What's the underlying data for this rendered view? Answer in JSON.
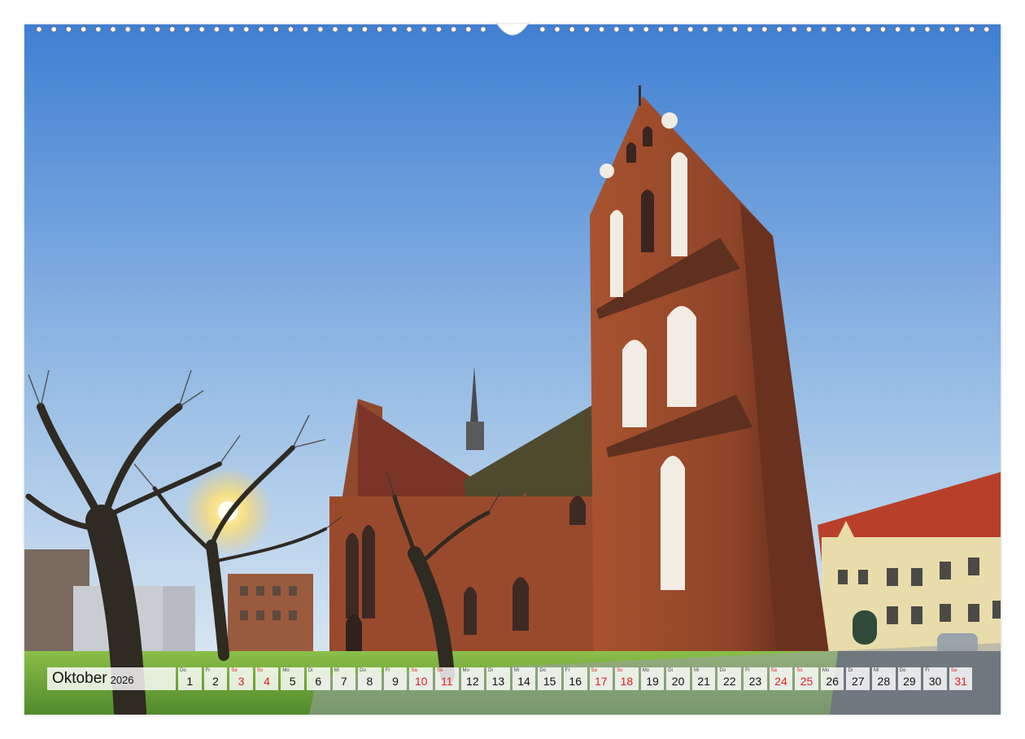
{
  "calendar": {
    "month": "Oktober",
    "year": "2026",
    "days": [
      {
        "wd": "Do",
        "n": "1",
        "weekend": false
      },
      {
        "wd": "Fr",
        "n": "2",
        "weekend": false
      },
      {
        "wd": "Sa",
        "n": "3",
        "weekend": true
      },
      {
        "wd": "So",
        "n": "4",
        "weekend": true
      },
      {
        "wd": "Mo",
        "n": "5",
        "weekend": false
      },
      {
        "wd": "Di",
        "n": "6",
        "weekend": false
      },
      {
        "wd": "Mi",
        "n": "7",
        "weekend": false
      },
      {
        "wd": "Do",
        "n": "8",
        "weekend": false
      },
      {
        "wd": "Fr",
        "n": "9",
        "weekend": false
      },
      {
        "wd": "Sa",
        "n": "10",
        "weekend": true
      },
      {
        "wd": "So",
        "n": "11",
        "weekend": true
      },
      {
        "wd": "Mo",
        "n": "12",
        "weekend": false
      },
      {
        "wd": "Di",
        "n": "13",
        "weekend": false
      },
      {
        "wd": "Mi",
        "n": "14",
        "weekend": false
      },
      {
        "wd": "Do",
        "n": "15",
        "weekend": false
      },
      {
        "wd": "Fr",
        "n": "16",
        "weekend": false
      },
      {
        "wd": "Sa",
        "n": "17",
        "weekend": true
      },
      {
        "wd": "So",
        "n": "18",
        "weekend": true
      },
      {
        "wd": "Mo",
        "n": "19",
        "weekend": false
      },
      {
        "wd": "Di",
        "n": "20",
        "weekend": false
      },
      {
        "wd": "Mi",
        "n": "21",
        "weekend": false
      },
      {
        "wd": "Do",
        "n": "22",
        "weekend": false
      },
      {
        "wd": "Fr",
        "n": "23",
        "weekend": false
      },
      {
        "wd": "Sa",
        "n": "24",
        "weekend": true
      },
      {
        "wd": "So",
        "n": "25",
        "weekend": true
      },
      {
        "wd": "Mo",
        "n": "26",
        "weekend": false
      },
      {
        "wd": "Di",
        "n": "27",
        "weekend": false
      },
      {
        "wd": "Mi",
        "n": "28",
        "weekend": false
      },
      {
        "wd": "Do",
        "n": "29",
        "weekend": false
      },
      {
        "wd": "Fr",
        "n": "30",
        "weekend": false
      },
      {
        "wd": "Sa",
        "n": "31",
        "weekend": true
      }
    ]
  },
  "colors": {
    "weekend": "#e02020",
    "sky_top": "#4a86d6",
    "sky_bottom": "#dfe9f2",
    "brick": "#9a4a2c",
    "roof": "#8e3a2a",
    "grass": "#6fa838"
  }
}
